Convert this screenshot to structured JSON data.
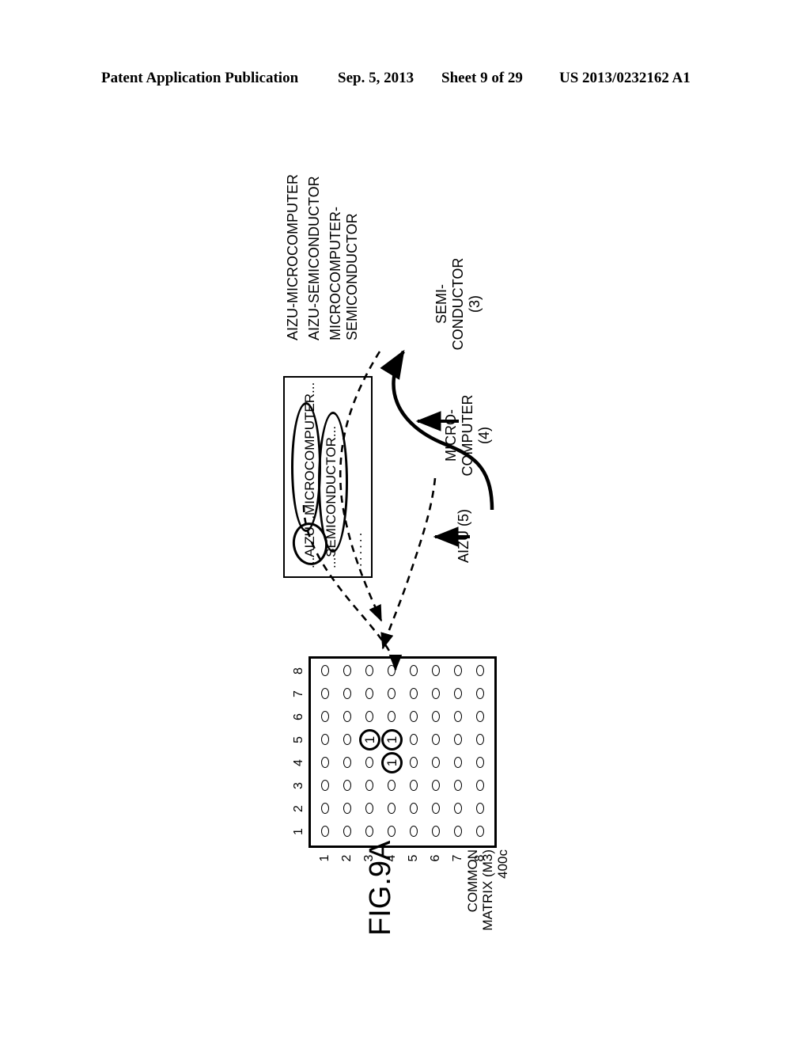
{
  "header": {
    "publication": "Patent Application Publication",
    "date": "Sep. 5, 2013",
    "sheet": "Sheet 9 of 29",
    "number": "US 2013/0232162 A1"
  },
  "figure": {
    "label": "FIG.9A"
  },
  "matrix": {
    "caption": "COMMON\nMATRIX (M3)\n400c",
    "column_labels": [
      "1",
      "2",
      "3",
      "4",
      "5",
      "6",
      "7",
      "8"
    ],
    "row_labels": [
      "1",
      "2",
      "3",
      "4",
      "5",
      "6",
      "7",
      "8"
    ],
    "zero_glyph": "0",
    "one_glyph": "1",
    "cells": [
      [
        "0",
        "0",
        "0",
        "0",
        "0",
        "0",
        "0",
        "0"
      ],
      [
        "0",
        "0",
        "0",
        "0",
        "0",
        "0",
        "0",
        "0"
      ],
      [
        "0",
        "0",
        "0",
        "0",
        "1",
        "0",
        "0",
        "0"
      ],
      [
        "0",
        "0",
        "0",
        "1",
        "1",
        "0",
        "0",
        "0"
      ],
      [
        "0",
        "0",
        "0",
        "0",
        "0",
        "0",
        "0",
        "0"
      ],
      [
        "0",
        "0",
        "0",
        "0",
        "0",
        "0",
        "0",
        "0"
      ],
      [
        "0",
        "0",
        "0",
        "0",
        "0",
        "0",
        "0",
        "0"
      ],
      [
        "0",
        "0",
        "0",
        "0",
        "0",
        "0",
        "0",
        "0"
      ]
    ],
    "highlighted": [
      {
        "row": 3,
        "col": 5
      },
      {
        "row": 4,
        "col": 4
      },
      {
        "row": 4,
        "col": 5
      }
    ]
  },
  "document_box": {
    "line1": "...AIZU...MICROCOMPUTER...",
    "line2": "...SEMICONDUCTOR...",
    "ellipsis": "......",
    "circled_terms": [
      "AIZU",
      "MICROCOMPUTER",
      "SEMICONDUCTOR"
    ]
  },
  "pair_labels": {
    "aizu_microcomputer": "AIZU-MICROCOMPUTER",
    "aizu_semiconductor": "AIZU-SEMICONDUCTOR",
    "microcomputer_semiconductor": "MICROCOMPUTER-\nSEMICONDUCTOR"
  },
  "term_labels": {
    "aizu": "AIZU (5)",
    "microcomputer": "MICRO-\nCOMPUTER (4)",
    "semiconductor": "SEMI-\nCONDUCTOR (3)"
  },
  "colors": {
    "ink": "#000000",
    "paper": "#ffffff"
  }
}
